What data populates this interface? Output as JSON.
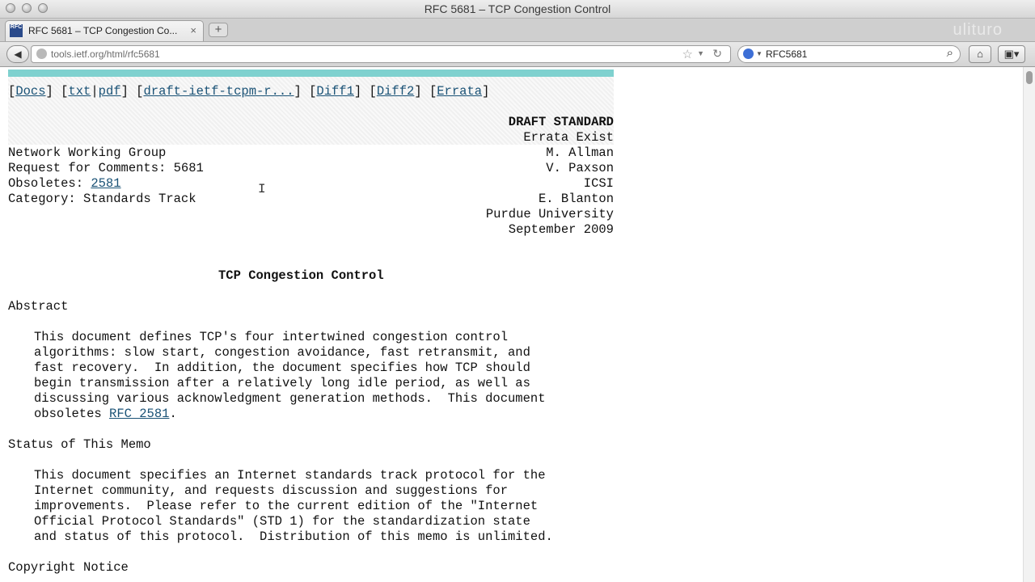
{
  "window": {
    "title": "RFC 5681 – TCP Congestion Control"
  },
  "tab": {
    "label": "RFC 5681 – TCP Congestion Co...",
    "favicon_text": "RFC"
  },
  "watermark": "ulituro",
  "navbar": {
    "url": "tools.ietf.org/html/rfc5681",
    "search_value": "RFC5681",
    "icons": [
      "back-icon",
      "globe-icon",
      "star-icon",
      "reload-icon",
      "search-icon",
      "home-icon",
      "extension-icon"
    ]
  },
  "doc": {
    "nav": {
      "docs": "Docs",
      "txt": "txt",
      "pdf": "pdf",
      "draft": "draft-ietf-tcpm-r...",
      "diff1": "Diff1",
      "diff2": "Diff2",
      "errata": "Errata"
    },
    "status": {
      "line1": "DRAFT STANDARD",
      "line2": "Errata Exist"
    },
    "left_header": {
      "group": "Network Working Group",
      "rfc": "Request for Comments: 5681",
      "obsoletes_label": "Obsoletes: ",
      "obsoletes_link": "2581",
      "category": "Category: Standards Track"
    },
    "right_header": [
      "M. Allman",
      "V. Paxson",
      "ICSI",
      "E. Blanton",
      "Purdue University",
      "September 2009"
    ],
    "title": "TCP Congestion Control",
    "abstract": {
      "heading": "Abstract",
      "lines": [
        "This document defines TCP's four intertwined congestion control",
        "algorithms: slow start, congestion avoidance, fast retransmit, and",
        "fast recovery.  In addition, the document specifies how TCP should",
        "begin transmission after a relatively long idle period, as well as",
        "discussing various acknowledgment generation methods.  This document"
      ],
      "last_prefix": "obsoletes ",
      "last_link": "RFC 2581",
      "last_suffix": "."
    },
    "status_memo": {
      "heading": "Status of This Memo",
      "lines": [
        "This document specifies an Internet standards track protocol for the",
        "Internet community, and requests discussion and suggestions for",
        "improvements.  Please refer to the current edition of the \"Internet",
        "Official Protocol Standards\" (STD 1) for the standardization state",
        "and status of this protocol.  Distribution of this memo is unlimited."
      ]
    },
    "copyright": {
      "heading": "Copyright Notice"
    }
  }
}
